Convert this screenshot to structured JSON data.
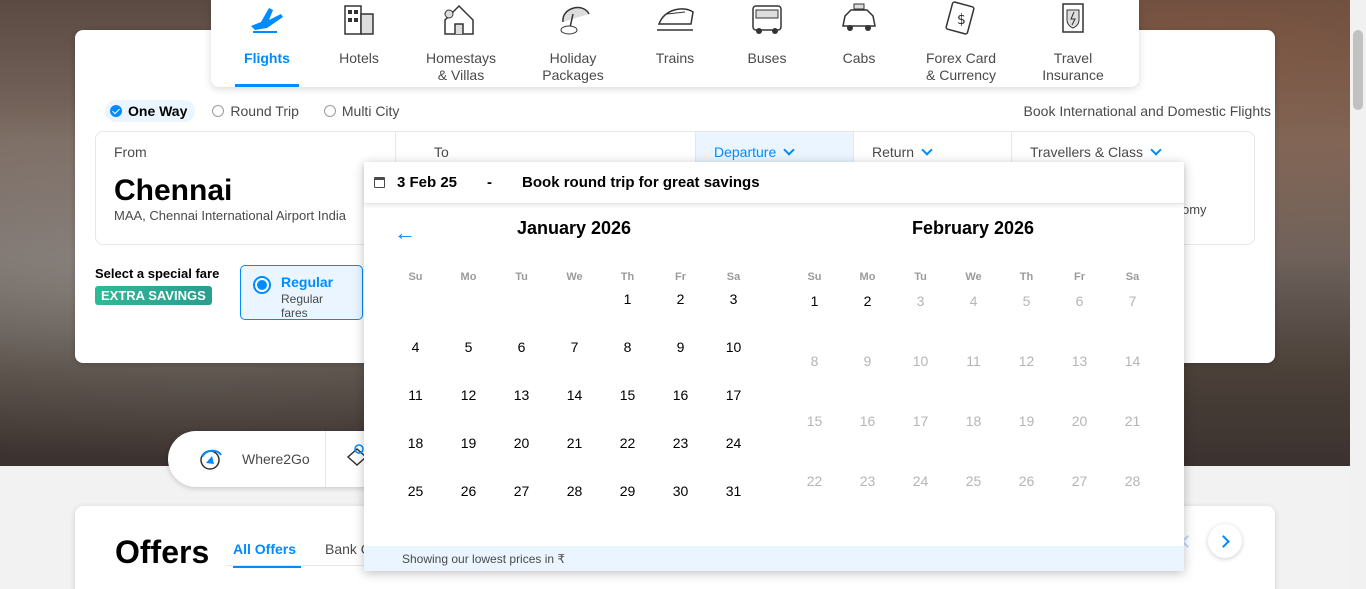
{
  "nav": [
    {
      "label_l1": "Flights",
      "label_l2": "",
      "icon": "plane-icon",
      "active": true
    },
    {
      "label_l1": "Hotels",
      "label_l2": "",
      "icon": "hotel-icon"
    },
    {
      "label_l1": "Homestays",
      "label_l2": "& Villas",
      "icon": "homestay-icon"
    },
    {
      "label_l1": "Holiday",
      "label_l2": "Packages",
      "icon": "holiday-icon"
    },
    {
      "label_l1": "Trains",
      "label_l2": "",
      "icon": "train-icon"
    },
    {
      "label_l1": "Buses",
      "label_l2": "",
      "icon": "bus-icon"
    },
    {
      "label_l1": "Cabs",
      "label_l2": "",
      "icon": "cab-icon"
    },
    {
      "label_l1": "Forex Card",
      "label_l2": "& Currency",
      "icon": "forex-icon"
    },
    {
      "label_l1": "Travel",
      "label_l2": "Insurance",
      "icon": "insurance-icon"
    }
  ],
  "trip_types": {
    "one_way": "One Way",
    "round_trip": "Round Trip",
    "multi_city": "Multi City",
    "selected": "One Way"
  },
  "book_intl": "Book International and Domestic Flights",
  "fields": {
    "from_label": "From",
    "from_city": "Chennai",
    "from_airport": "MAA, Chennai International Airport India",
    "to_label": "To",
    "departure_label": "Departure",
    "return_label": "Return",
    "travellers_label": "Travellers & Class",
    "class_partial": "omy"
  },
  "special_fare": {
    "title": "Select a special fare",
    "badge": "EXTRA SAVINGS",
    "option_name": "Regular",
    "option_sub": "Regular fares"
  },
  "where2go": {
    "label": "Where2Go"
  },
  "offers": {
    "title": "Offers",
    "tab_all": "All Offers",
    "tab_bank": "Bank O"
  },
  "calendar": {
    "selected_date": "3 Feb 25",
    "dash": "-",
    "round_trip_prompt": "Book round trip for great savings",
    "prev_arrow": "←",
    "weekdays": [
      "Su",
      "Mo",
      "Tu",
      "We",
      "Th",
      "Fr",
      "Sa"
    ],
    "month1": {
      "title": "January 2026",
      "lead_blanks": 4,
      "days": [
        "1",
        "2",
        "3",
        "4",
        "5",
        "6",
        "7",
        "8",
        "9",
        "10",
        "11",
        "12",
        "13",
        "14",
        "15",
        "16",
        "17",
        "18",
        "19",
        "20",
        "21",
        "22",
        "23",
        "24",
        "25",
        "26",
        "27",
        "28",
        "29",
        "30",
        "31"
      ],
      "disabled_from": 99
    },
    "month2": {
      "title": "February 2026",
      "lead_blanks": 0,
      "days": [
        "1",
        "2",
        "3",
        "4",
        "5",
        "6",
        "7",
        "8",
        "9",
        "10",
        "11",
        "12",
        "13",
        "14",
        "15",
        "16",
        "17",
        "18",
        "19",
        "20",
        "21",
        "22",
        "23",
        "24",
        "25",
        "26",
        "27",
        "28"
      ],
      "disabled_from": 3
    },
    "footer": "Showing our lowest prices in ₹"
  },
  "colors": {
    "accent": "#008cff",
    "accent_light": "#eaf5ff",
    "text": "#4a4a4a",
    "disabled": "#b5b5b5",
    "badge": "#32b796"
  }
}
